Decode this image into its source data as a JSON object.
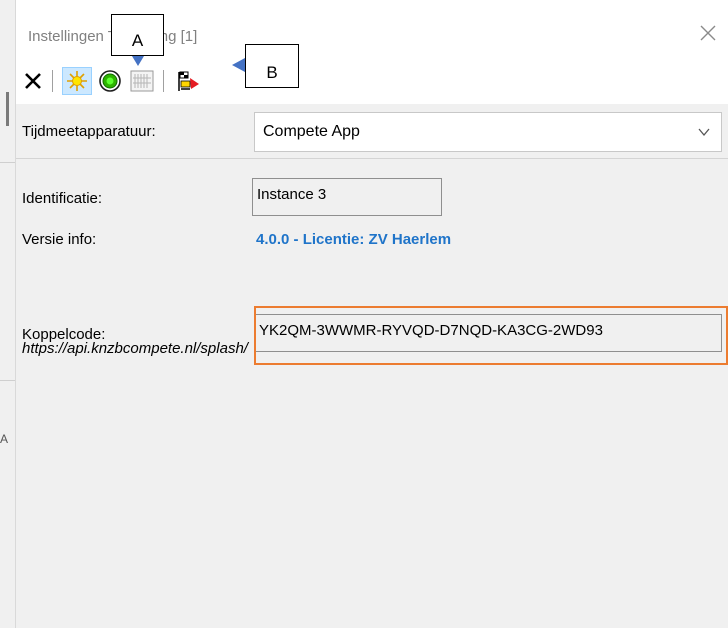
{
  "window": {
    "title": "Instellingen Tijdmeting [1]"
  },
  "toolbar": {
    "buttons": [
      {
        "icon": "close-x-icon"
      },
      {
        "icon": "sun-icon",
        "active": true
      },
      {
        "icon": "green-target-icon"
      },
      {
        "icon": "barcode-grid-icon"
      },
      {
        "icon": "flag-config-icon"
      }
    ]
  },
  "form": {
    "device_label": "Tijdmeetapparatuur:",
    "device_value": "Compete App",
    "id_label": "Identificatie:",
    "id_value": "Instance 3",
    "version_label": "Versie info:",
    "version_value": "4.0.0 - Licentie: ZV Haerlem",
    "pair_label": "Koppelcode:",
    "pair_value": "YK2QM-3WWMR-RYVQD-D7NQD-KA3CG-2WD93",
    "url": "https://api.knzbcompete.nl/splash/"
  },
  "annotations": {
    "a": "A",
    "b": "B"
  },
  "colors": {
    "link": "#1f74c9",
    "highlight": "#ec7c30",
    "pointer": "#4472c4",
    "active_bg": "#cce8ff"
  }
}
